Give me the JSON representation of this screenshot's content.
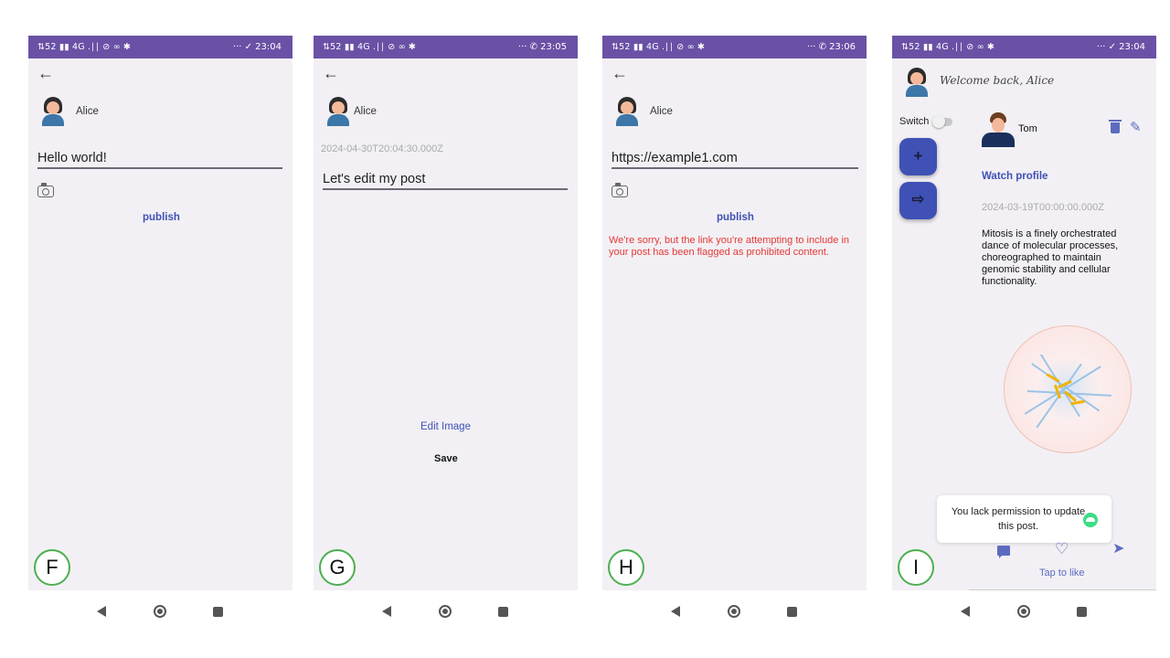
{
  "panels": {
    "f": {
      "status_left": "⇅52 ▮▮ 4G .∣∣ ⊘ ∞ ✱",
      "time": "23:04",
      "status_right_prefix": "··· ✓",
      "username": "Alice",
      "post_text": "Hello world!",
      "publish_label": "publish",
      "tag": "F"
    },
    "g": {
      "status_left": "⇅52 ▮▮ 4G .∣∣ ⊘ ∞ ✱",
      "time": "23:05",
      "status_right_prefix": "··· ✆",
      "username": "Alice",
      "timestamp": "2024-04-30T20:04:30.000Z",
      "post_text": "Let's edit my post",
      "edit_image_label": "Edit Image",
      "save_label": "Save",
      "tag": "G"
    },
    "h": {
      "status_left": "⇅52 ▮▮ 4G .∣∣ ⊘ ∞ ✱",
      "time": "23:06",
      "status_right_prefix": "··· ✆",
      "username": "Alice",
      "post_text": "https://example1.com",
      "publish_label": "publish",
      "error_message": "We're sorry, but the link you're attempting to include in your post has been flagged as prohibited content.",
      "tag": "H"
    },
    "i": {
      "status_left": "⇅52 ▮▮ 4G .∣∣ ⊘ ∞ ✱",
      "time": "23:04",
      "status_right_prefix": "··· ✓",
      "welcome": "Welcome back, Alice",
      "switch_label": "Switch",
      "add_icon": "+",
      "logout_icon": "⇨",
      "post_author": "Tom",
      "watch_profile": "Watch profile",
      "timestamp": "2024-03-19T00:00:00.000Z",
      "post_text": "Mitosis is a finely orchestrated dance of molecular processes, choreographed to maintain genomic stability and cellular functionality.",
      "toast": "You lack permission to update this post.",
      "tap_to_like": "Tap to like",
      "tag": "I"
    }
  },
  "icons": {
    "back": "back-arrow-icon",
    "camera": "camera-icon",
    "trash": "trash-icon",
    "pencil": "pencil-icon",
    "comment": "comment-icon",
    "heart": "heart-icon",
    "share": "share-icon"
  },
  "colors": {
    "status_bar": "#6a51a6",
    "screen_bg": "#f2f0f4",
    "accent": "#3f51b5",
    "error": "#e53935",
    "tag_border": "#4caf50"
  }
}
